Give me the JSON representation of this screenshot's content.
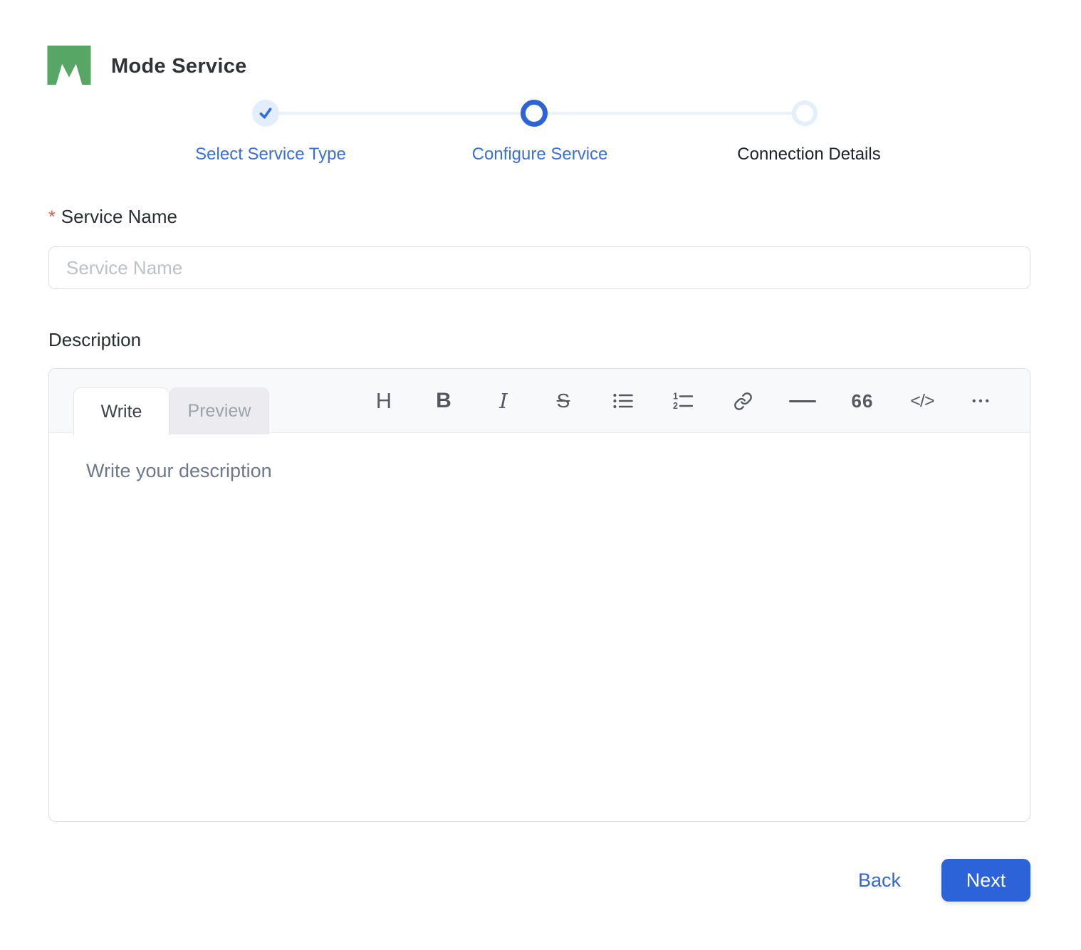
{
  "app": {
    "title": "Mode Service"
  },
  "stepper": {
    "steps": [
      {
        "label": "Select Service Type",
        "state": "completed"
      },
      {
        "label": "Configure Service",
        "state": "active"
      },
      {
        "label": "Connection Details",
        "state": "upcoming"
      }
    ]
  },
  "form": {
    "service_name": {
      "required_marker": "*",
      "label": "Service Name",
      "placeholder": "Service Name",
      "value": ""
    },
    "description": {
      "label": "Description",
      "placeholder": "Write your description",
      "value": ""
    }
  },
  "editor": {
    "tabs": [
      {
        "label": "Write",
        "active": true
      },
      {
        "label": "Preview",
        "active": false
      }
    ],
    "toolbar": [
      {
        "name": "heading",
        "glyph": "H"
      },
      {
        "name": "bold",
        "glyph": "B"
      },
      {
        "name": "italic",
        "glyph": "I"
      },
      {
        "name": "strikethrough",
        "glyph": "S"
      },
      {
        "name": "unordered-list",
        "glyph": ""
      },
      {
        "name": "ordered-list",
        "glyph": ""
      },
      {
        "name": "link",
        "glyph": ""
      },
      {
        "name": "horizontal-rule",
        "glyph": ""
      },
      {
        "name": "quote",
        "glyph": "66"
      },
      {
        "name": "code",
        "glyph": "</>"
      },
      {
        "name": "more",
        "glyph": "•••"
      }
    ]
  },
  "actions": {
    "back_label": "Back",
    "next_label": "Next"
  },
  "colors": {
    "brand_green": "#58A666",
    "primary_blue": "#2D63D8",
    "step_label_blue": "#3A6FD8",
    "completed_circle_bg": "#E3EDFB",
    "upcoming_ring": "#E4EFFC",
    "connector": "#E9F1FB",
    "required_red": "#E0574E"
  }
}
